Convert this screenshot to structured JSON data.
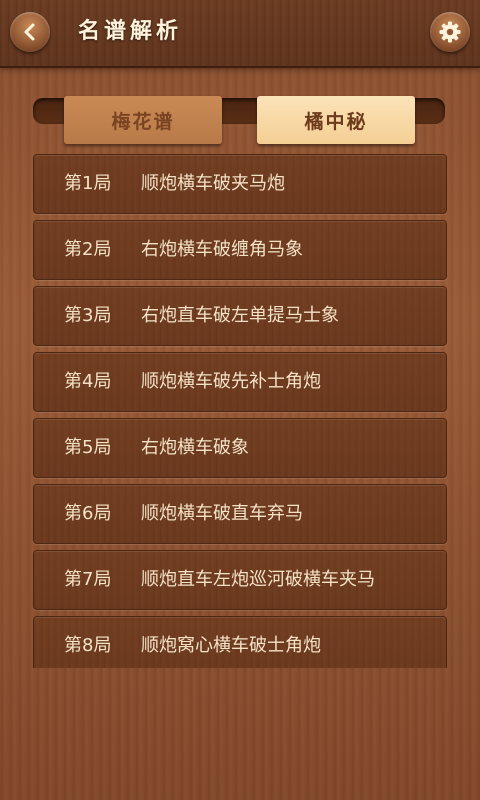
{
  "header": {
    "title": "名谱解析",
    "back_icon": "back-arrow-icon",
    "settings_icon": "gear-icon"
  },
  "tabs": [
    {
      "label": "梅花谱",
      "active": false
    },
    {
      "label": "橘中秘",
      "active": true
    }
  ],
  "games": [
    {
      "number": "第1局",
      "name": "顺炮横车破夹马炮"
    },
    {
      "number": "第2局",
      "name": "右炮横车破缠角马象"
    },
    {
      "number": "第3局",
      "name": "右炮直车破左单提马士象"
    },
    {
      "number": "第4局",
      "name": "顺炮横车破先补士角炮"
    },
    {
      "number": "第5局",
      "name": "右炮横车破象"
    },
    {
      "number": "第6局",
      "name": "顺炮横车破直车弃马"
    },
    {
      "number": "第7局",
      "name": "顺炮直车左炮巡河破横车夹马"
    },
    {
      "number": "第8局",
      "name": "顺炮窝心横车破士角炮"
    }
  ],
  "colors": {
    "background": "#9a5b37",
    "row_text": "#f4e2c6",
    "active_tab": "#f4cf94",
    "inactive_tab": "#b87a48"
  }
}
